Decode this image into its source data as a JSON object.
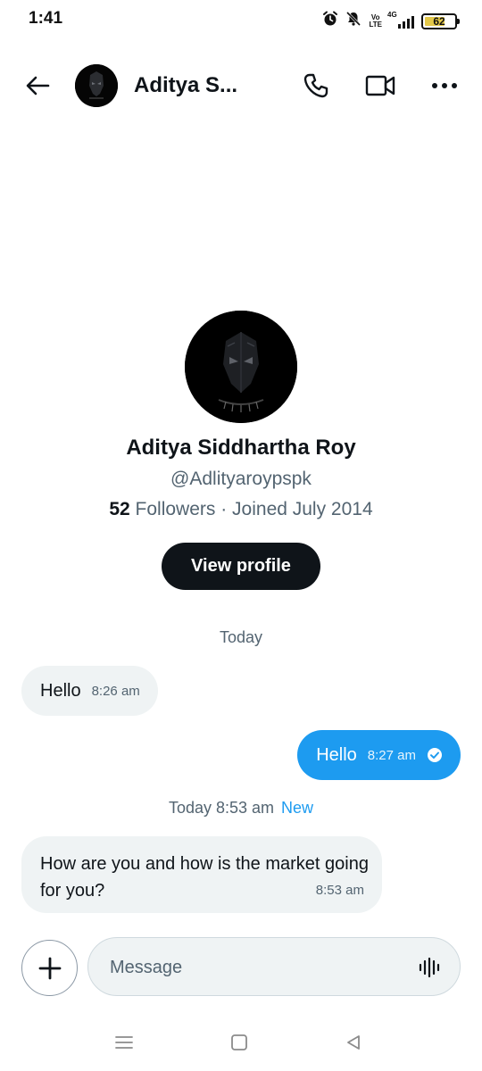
{
  "status_bar": {
    "time": "1:41",
    "volte_top": "Vo",
    "volte_bottom": "LTE",
    "network": "4G",
    "battery_level": "62",
    "icons": [
      "alarm-icon",
      "mute-icon",
      "volte-icon",
      "signal-icon",
      "battery-icon"
    ]
  },
  "header": {
    "title": "Aditya S...",
    "icons": [
      "back-arrow-icon",
      "phone-icon",
      "video-icon",
      "more-icon"
    ]
  },
  "profile": {
    "name": "Aditya Siddhartha Roy",
    "handle": "@Adlityaroypspk",
    "followers_count": "52",
    "followers_label": " Followers · Joined July 2014",
    "view_profile_label": "View profile"
  },
  "conversation": {
    "day_separator": "Today",
    "messages": [
      {
        "direction": "incoming",
        "text": "Hello",
        "time": "8:26 am"
      },
      {
        "direction": "outgoing",
        "text": "Hello",
        "time": "8:27 am",
        "read": true
      },
      {
        "direction": "incoming",
        "text": "How are you and how is the market going for you?",
        "time": "8:53 am"
      }
    ],
    "new_separator_time": "Today 8:53 am",
    "new_separator_label": "New"
  },
  "composer": {
    "placeholder": "Message",
    "value": ""
  },
  "colors": {
    "accent": "#1d9bf0",
    "text_primary": "#0f1419",
    "text_secondary": "#536471",
    "bubble_incoming": "#eff3f4"
  }
}
